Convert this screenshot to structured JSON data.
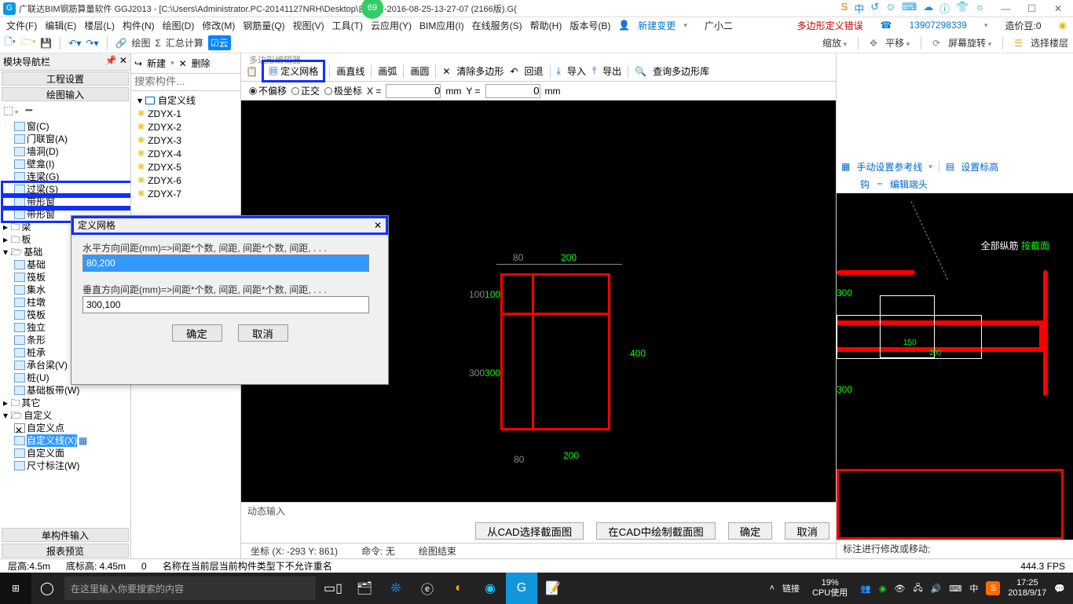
{
  "title": "广联达BIM钢筋算量软件 GGJ2013 - [C:\\Users\\Administrator.PC-20141127NRH\\Desktop\\白龙村-2016-08-25-13-27-07 (2166版).G(",
  "badge": "69",
  "sysicons": [
    "中",
    "↺",
    "☺",
    "⌨",
    "☁",
    "ⓘ",
    "👕",
    "☼"
  ],
  "menu": [
    "文件(F)",
    "编辑(E)",
    "楼层(L)",
    "构件(N)",
    "绘图(D)",
    "修改(M)",
    "钢筋量(Q)",
    "视图(V)",
    "工具(T)",
    "云应用(Y)",
    "BIM应用(I)",
    "在线服务(S)",
    "帮助(H)",
    "版本号(B)"
  ],
  "menu_newchange": "新建变更",
  "menu_user": "广小二",
  "menu_err": "多边形定义错误",
  "menu_phone": "13907298339",
  "menu_bean": "造价豆:0",
  "tb1": {
    "draw": "绘图",
    "summary": "汇总计算"
  },
  "tb1_right": {
    "zoom": "缩放",
    "pan": "平移",
    "rot": "屏幕旋转",
    "floor": "选择楼层"
  },
  "left": {
    "hdr": "模块导航栏",
    "sec1": "工程设置",
    "sec2": "绘图输入",
    "tree": [
      "窗(C)",
      "门联窗(A)",
      "墙洞(D)",
      "壁龛(I)",
      "连梁(G)",
      "过梁(S)",
      "带形窗",
      "带形窗"
    ],
    "groups": [
      "梁",
      "板",
      "基础"
    ],
    "found": [
      "基础",
      "筏板",
      "集水",
      "柱墩",
      "筏板",
      "独立",
      "条形",
      "桩承",
      "承台梁(V)",
      "桩(U)",
      "基础板带(W)"
    ],
    "other": "其它",
    "custom": "自定义",
    "customs": [
      "自定义点",
      "自定义线(X)",
      "自定义面",
      "尺寸标注(W)"
    ],
    "sec3": "单构件输入",
    "sec4": "报表预览"
  },
  "mid": {
    "new": "新建",
    "del": "删除",
    "search_ph": "搜索构件...",
    "root": "自定义线",
    "items": [
      "ZDYX-1",
      "ZDYX-2",
      "ZDYX-3",
      "ZDYX-4",
      "ZDYX-5",
      "ZDYX-6",
      "ZDYX-7"
    ]
  },
  "ctb": {
    "name": "多边形编辑器",
    "defgrid": "定义网格",
    "line": "画直线",
    "arc": "画弧",
    "circle": "画圆",
    "clear": "清除多边形",
    "back": "回退",
    "imp": "导入",
    "exp": "导出",
    "query": "查询多边形库"
  },
  "coord": {
    "r1": "不偏移",
    "r2": "正交",
    "r3": "极坐标",
    "xl": "X =",
    "xv": "0",
    "xu": "mm",
    "yl": "Y =",
    "yv": "0",
    "yu": "mm"
  },
  "diagram_left": {
    "top1": "80",
    "top2": "200",
    "left1": "100",
    "left1g": "100",
    "left2": "300",
    "left2g": "300",
    "right": "400",
    "bot1": "80",
    "bot2": "200"
  },
  "dyn": "动态输入",
  "btns": {
    "cad1": "从CAD选择截面图",
    "cad2": "在CAD中绘制截面图",
    "ok": "确定",
    "cancel": "取消"
  },
  "status": {
    "coord": "坐标 (X: -293 Y: 861)",
    "cmd": "命令: 无",
    "draw": "绘图结束"
  },
  "right": {
    "ref": "手动设置参考线",
    "mark": "设置标高",
    "hook": "钩",
    "end": "编辑端头",
    "title1": "全部纵筋",
    "title2": "按截面",
    "d1": "300",
    "d2": "150",
    "d3": "200",
    "d4": "300",
    "status": "标注进行修改或移动;"
  },
  "bottom": {
    "h": "层高:4.5m",
    "bh": "底标高: 4.45m",
    "z": "0",
    "msg": "名称在当前层当前构件类型下不允许重名",
    "fps": "444.3 FPS"
  },
  "taskbar": {
    "search_ph": "在这里输入你要搜索的内容",
    "link": "链接",
    "cpu1": "19%",
    "cpu2": "CPU使用",
    "time": "17:25",
    "date": "2018/9/17",
    "ime": "中"
  },
  "dialog": {
    "title": "定义网格",
    "close": "✕",
    "lbl1": "水平方向间距(mm)=>间距*个数, 间距, 间距*个数, 间距, . . .",
    "v1": "80,200",
    "lbl2": "垂直方向间距(mm)=>间距*个数, 间距, 间距*个数, 间距, . . .",
    "v2": "300,100",
    "ok": "确定",
    "cancel": "取消"
  }
}
